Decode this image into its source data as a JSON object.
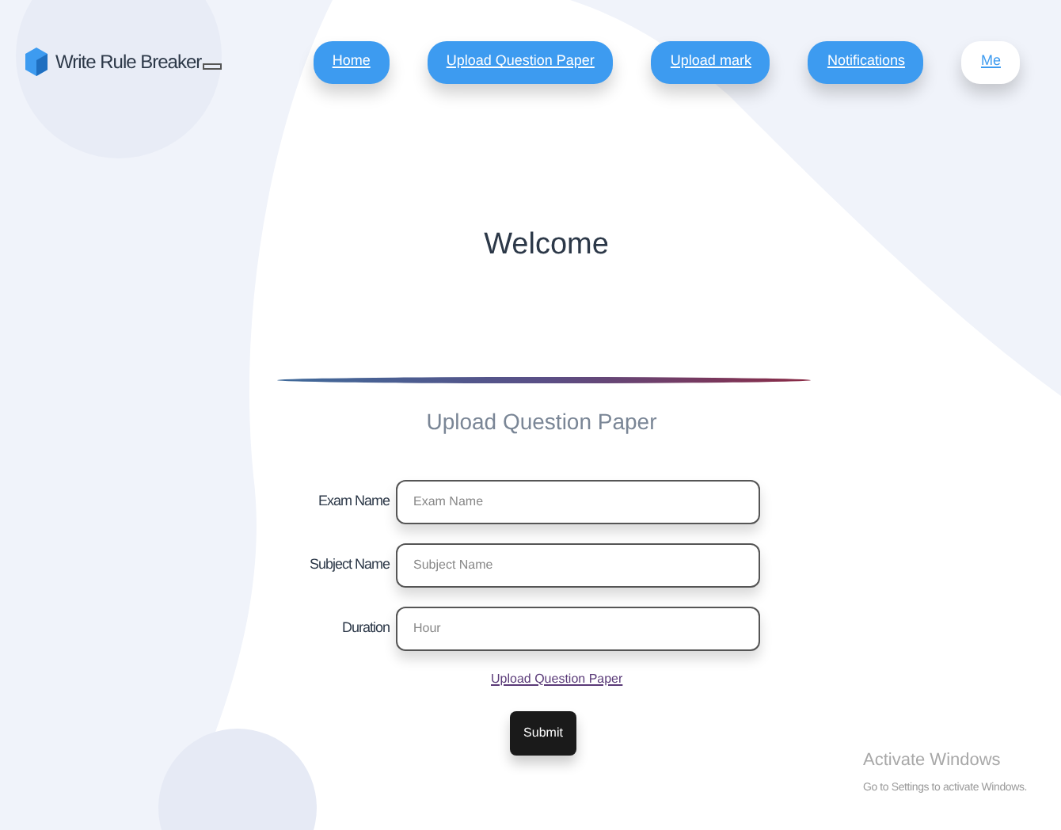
{
  "brand": {
    "name": "Write Rule Breaker"
  },
  "nav": [
    {
      "label": "Home",
      "kind": "link"
    },
    {
      "label": "Upload Question Paper",
      "kind": "link"
    },
    {
      "label": "Upload mark",
      "kind": "link"
    },
    {
      "label": "Notifications",
      "kind": "link"
    },
    {
      "label": "Me",
      "kind": "profile"
    }
  ],
  "heading": "Welcome",
  "form": {
    "title": "Upload Question Paper",
    "fields": [
      {
        "label": "Exam Name",
        "placeholder": "Exam Name"
      },
      {
        "label": "Subject Name",
        "placeholder": "Subject Name"
      },
      {
        "label": "Duration",
        "placeholder": "Hour"
      }
    ],
    "file_link": "Upload Question Paper",
    "submit": "Submit"
  },
  "os_notice": {
    "title": "Activate Windows",
    "text": "Go to Settings to activate Windows."
  }
}
